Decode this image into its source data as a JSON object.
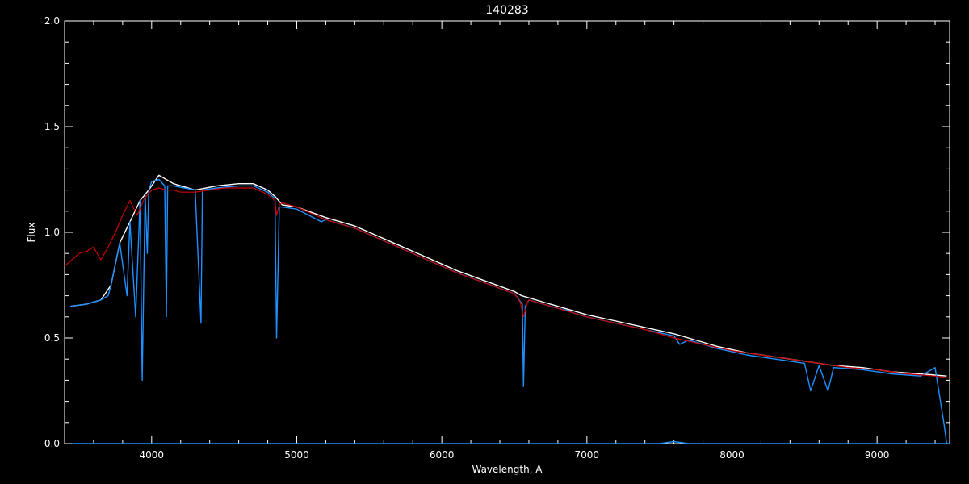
{
  "chart_data": {
    "type": "line",
    "title": "140283",
    "xlabel": "Wavelength, A",
    "ylabel": "Flux",
    "xlim": [
      3400,
      9500
    ],
    "ylim": [
      0.0,
      2.0
    ],
    "x_ticks": [
      4000,
      5000,
      6000,
      7000,
      8000,
      9000
    ],
    "x_tick_labels": [
      "4000",
      "5000",
      "6000",
      "7000",
      "8000",
      "9000"
    ],
    "y_ticks": [
      0.0,
      0.5,
      1.0,
      1.5,
      2.0
    ],
    "y_tick_labels": [
      "0.0",
      "0.5",
      "1.0",
      "1.5",
      "2.0"
    ],
    "grid": false,
    "colors": {
      "background": "#000000",
      "axes": "#ffffff"
    },
    "series": [
      {
        "color": "#ffffff",
        "x": [
          3440,
          3550,
          3650,
          3720,
          3780,
          3850,
          3920,
          3980,
          4050,
          4150,
          4300,
          4450,
          4600,
          4700,
          4800,
          4850,
          4900,
          5000,
          5200,
          5400,
          5500,
          5700,
          5900,
          6100,
          6300,
          6500,
          6550,
          6600,
          6700,
          6800,
          7000,
          7200,
          7400,
          7600,
          7700,
          7900,
          8100,
          8300,
          8500,
          8700,
          8900,
          9100,
          9300,
          9480
        ],
        "y": [
          0.65,
          0.66,
          0.68,
          0.75,
          0.95,
          1.05,
          1.15,
          1.2,
          1.27,
          1.23,
          1.2,
          1.22,
          1.23,
          1.23,
          1.2,
          1.17,
          1.13,
          1.12,
          1.07,
          1.03,
          1.0,
          0.94,
          0.88,
          0.82,
          0.77,
          0.72,
          0.7,
          0.69,
          0.67,
          0.65,
          0.61,
          0.58,
          0.55,
          0.52,
          0.5,
          0.46,
          0.43,
          0.41,
          0.39,
          0.37,
          0.36,
          0.34,
          0.33,
          0.32
        ]
      },
      {
        "color": "#1e90ff",
        "x": [
          3440,
          3550,
          3650,
          3700,
          3720,
          3780,
          3830,
          3850,
          3890,
          3920,
          3935,
          3955,
          3970,
          3980,
          4000,
          4050,
          4090,
          4101,
          4110,
          4150,
          4300,
          4340,
          4350,
          4450,
          4600,
          4700,
          4800,
          4850,
          4861,
          4880,
          4900,
          5000,
          5170,
          5200,
          5400,
          5500,
          5700,
          5900,
          6100,
          6300,
          6500,
          6555,
          6563,
          6575,
          6600,
          6700,
          6800,
          6870,
          6900,
          7000,
          7200,
          7400,
          7600,
          7640,
          7700,
          7900,
          8100,
          8300,
          8500,
          8542,
          8600,
          8662,
          8700,
          8900,
          9100,
          9300,
          9400,
          9460,
          9480
        ],
        "y": [
          0.65,
          0.66,
          0.68,
          0.7,
          0.75,
          0.95,
          0.7,
          1.05,
          0.6,
          1.15,
          0.3,
          1.18,
          0.9,
          1.2,
          1.24,
          1.25,
          1.22,
          0.6,
          1.22,
          1.22,
          1.2,
          0.57,
          1.2,
          1.21,
          1.22,
          1.22,
          1.19,
          1.16,
          0.5,
          1.12,
          1.12,
          1.11,
          1.05,
          1.06,
          1.02,
          0.99,
          0.93,
          0.87,
          0.81,
          0.76,
          0.71,
          0.66,
          0.27,
          0.65,
          0.68,
          0.66,
          0.64,
          0.63,
          0.62,
          0.6,
          0.57,
          0.54,
          0.51,
          0.47,
          0.49,
          0.45,
          0.42,
          0.4,
          0.38,
          0.25,
          0.37,
          0.25,
          0.36,
          0.35,
          0.33,
          0.32,
          0.36,
          0.1,
          0.0
        ]
      },
      {
        "color": "#cc0000",
        "x": [
          3400,
          3450,
          3500,
          3550,
          3600,
          3650,
          3700,
          3750,
          3800,
          3850,
          3900,
          3950,
          4000,
          4050,
          4100,
          4150,
          4200,
          4300,
          4400,
          4500,
          4600,
          4700,
          4800,
          4850,
          4861,
          4880,
          4900,
          5000,
          5200,
          5400,
          5500,
          5700,
          5900,
          6100,
          6300,
          6500,
          6540,
          6563,
          6590,
          6600,
          6800,
          7000,
          7200,
          7400,
          7600,
          7800,
          8000,
          8200,
          8400,
          8600,
          8800,
          9000,
          9200,
          9400,
          9500
        ],
        "y": [
          0.84,
          0.87,
          0.9,
          0.91,
          0.93,
          0.87,
          0.93,
          1.0,
          1.08,
          1.15,
          1.08,
          1.16,
          1.2,
          1.21,
          1.2,
          1.2,
          1.19,
          1.19,
          1.2,
          1.21,
          1.21,
          1.21,
          1.18,
          1.15,
          1.08,
          1.13,
          1.14,
          1.12,
          1.06,
          1.02,
          0.99,
          0.93,
          0.87,
          0.81,
          0.76,
          0.71,
          0.67,
          0.6,
          0.67,
          0.68,
          0.64,
          0.6,
          0.57,
          0.54,
          0.5,
          0.47,
          0.44,
          0.42,
          0.4,
          0.38,
          0.36,
          0.35,
          0.33,
          0.32,
          0.31
        ]
      },
      {
        "color": "#1e90ff",
        "x": [
          3450,
          4000,
          4100,
          7500,
          7600,
          7700,
          9400,
          9500
        ],
        "y": [
          0.0,
          0.0,
          0.0,
          0.0,
          0.01,
          0.0,
          0.0,
          0.0
        ]
      }
    ]
  }
}
